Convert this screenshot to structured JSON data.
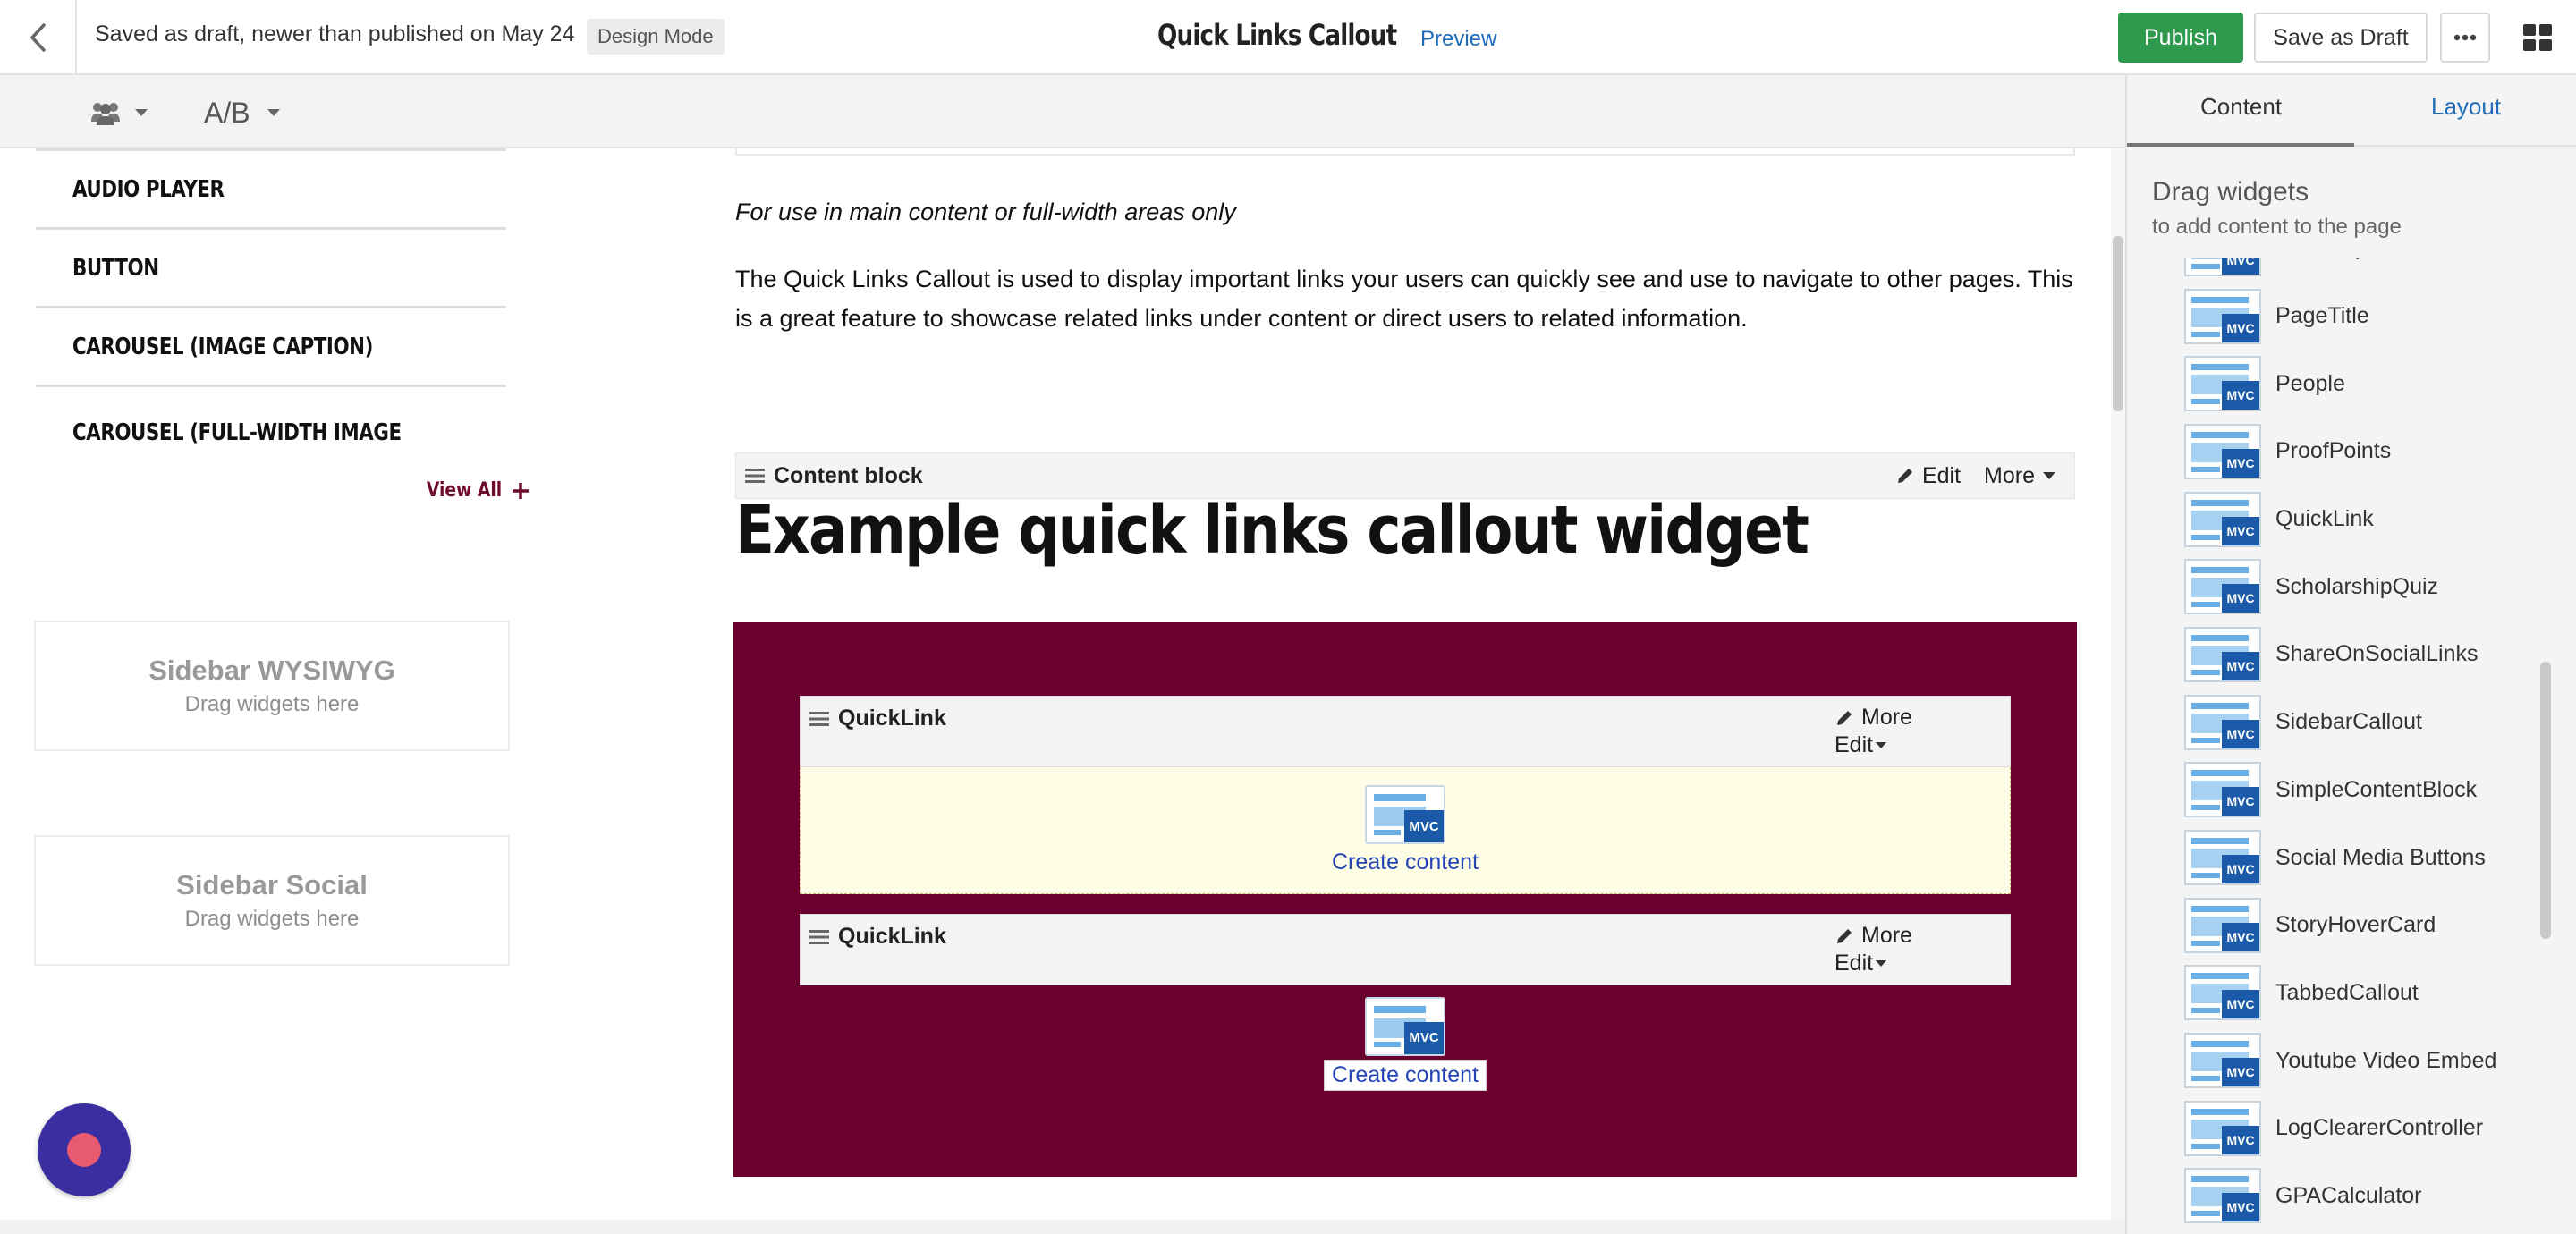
{
  "header": {
    "draft_status": "Saved as draft, newer than published on May 24",
    "mode_badge": "Design Mode",
    "page_title": "Quick Links Callout",
    "preview_label": "Preview",
    "publish_label": "Publish",
    "save_draft_label": "Save as Draft"
  },
  "toolbar": {
    "ab_label": "A/B"
  },
  "left_panel": {
    "widgets": [
      "AUDIO PLAYER",
      "BUTTON",
      "CAROUSEL (IMAGE CAPTION)",
      "CAROUSEL (FULL-WIDTH IMAGE BACKGROUND)"
    ],
    "view_all_label": "View All",
    "zones": [
      {
        "title": "Sidebar WYSIWYG",
        "subtitle": "Drag widgets here"
      },
      {
        "title": "Sidebar Social",
        "subtitle": "Drag widgets here"
      }
    ]
  },
  "main": {
    "italic_note": "For use in main content or full-width areas only",
    "description": "The Quick Links Callout is used to display important links your users can quickly see and use to navigate to other pages. This is a great feature to showcase related links under content or direct users to related information.",
    "content_block": {
      "label": "Content block",
      "edit_label": "Edit",
      "more_label": "More"
    },
    "example_heading": "Example quick links callout widget",
    "quicklinks": [
      {
        "title": "QuickLink",
        "more_label": "More",
        "edit_label": "Edit",
        "badge": "MVC",
        "create_label": "Create content"
      },
      {
        "title": "QuickLink",
        "more_label": "More",
        "edit_label": "Edit",
        "badge": "MVC",
        "create_label": "Create content"
      }
    ]
  },
  "right_panel": {
    "tabs": [
      "Content",
      "Layout"
    ],
    "active_tab": "Content",
    "title": "Drag widgets",
    "subtitle": "to add content to the page",
    "badge": "MVC",
    "widgets": [
      "NextStepsCallout",
      "PageTitle",
      "People",
      "ProofPoints",
      "QuickLink",
      "ScholarshipQuiz",
      "ShareOnSocialLinks",
      "SidebarCallout",
      "SimpleContentBlock",
      "Social Media Buttons",
      "StoryHoverCard",
      "TabbedCallout",
      "Youtube Video Embed",
      "LogClearerController",
      "GPACalculator"
    ]
  },
  "colors": {
    "publish": "#2e9a4e",
    "callout_bg": "#6b0030",
    "link": "#1e6bb8",
    "view_all": "#6e0a2c",
    "mvc_badge": "#1b5aa8",
    "record_button": "#3a2ea0"
  }
}
